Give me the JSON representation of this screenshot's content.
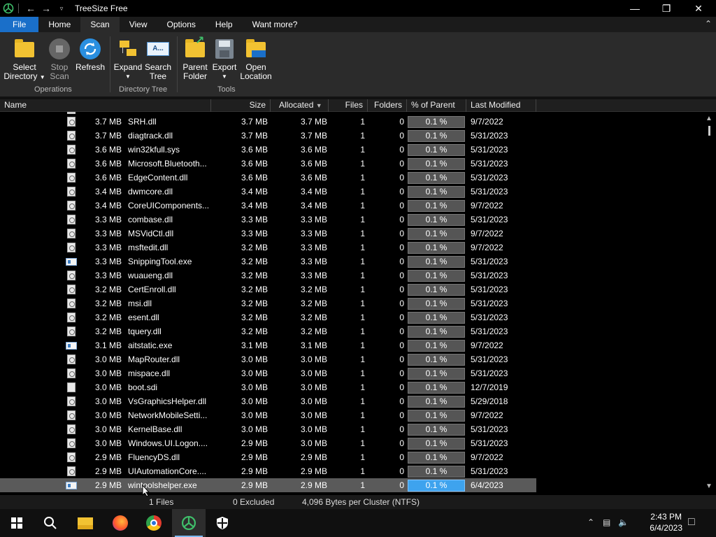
{
  "window": {
    "title": "TreeSize Free"
  },
  "menu": {
    "tabs": [
      "File",
      "Home",
      "Scan",
      "View",
      "Options",
      "Help",
      "Want more?"
    ],
    "active_tab": "Scan"
  },
  "ribbon": {
    "buttons": {
      "select_directory": "Select Directory",
      "stop_scan": "Stop Scan",
      "refresh": "Refresh",
      "expand": "Expand",
      "search_tree": "Search Tree",
      "parent_folder": "Parent Folder",
      "export": "Export",
      "open_location": "Open Location"
    },
    "groups": {
      "operations": "Operations",
      "directory_tree": "Directory Tree",
      "tools": "Tools"
    }
  },
  "columns": {
    "name": "Name",
    "size": "Size",
    "allocated": "Allocated",
    "files": "Files",
    "folders": "Folders",
    "pct_parent": "% of Parent ...",
    "last_modified": "Last Modified"
  },
  "rows": [
    {
      "icon": "dll",
      "tree_size": "3.7 MB",
      "name": "SRH.dll",
      "size": "3.7 MB",
      "allocated": "3.7 MB",
      "files": "1",
      "folders": "0",
      "pct": "0.1 %",
      "modified": "9/7/2022"
    },
    {
      "icon": "dll",
      "tree_size": "3.7 MB",
      "name": "diagtrack.dll",
      "size": "3.7 MB",
      "allocated": "3.7 MB",
      "files": "1",
      "folders": "0",
      "pct": "0.1 %",
      "modified": "5/31/2023"
    },
    {
      "icon": "dll",
      "tree_size": "3.6 MB",
      "name": "win32kfull.sys",
      "size": "3.6 MB",
      "allocated": "3.6 MB",
      "files": "1",
      "folders": "0",
      "pct": "0.1 %",
      "modified": "5/31/2023"
    },
    {
      "icon": "dll",
      "tree_size": "3.6 MB",
      "name": "Microsoft.Bluetooth...",
      "size": "3.6 MB",
      "allocated": "3.6 MB",
      "files": "1",
      "folders": "0",
      "pct": "0.1 %",
      "modified": "5/31/2023"
    },
    {
      "icon": "dll",
      "tree_size": "3.6 MB",
      "name": "EdgeContent.dll",
      "size": "3.6 MB",
      "allocated": "3.6 MB",
      "files": "1",
      "folders": "0",
      "pct": "0.1 %",
      "modified": "5/31/2023"
    },
    {
      "icon": "dll",
      "tree_size": "3.4 MB",
      "name": "dwmcore.dll",
      "size": "3.4 MB",
      "allocated": "3.4 MB",
      "files": "1",
      "folders": "0",
      "pct": "0.1 %",
      "modified": "5/31/2023"
    },
    {
      "icon": "dll",
      "tree_size": "3.4 MB",
      "name": "CoreUIComponents...",
      "size": "3.4 MB",
      "allocated": "3.4 MB",
      "files": "1",
      "folders": "0",
      "pct": "0.1 %",
      "modified": "9/7/2022"
    },
    {
      "icon": "dll",
      "tree_size": "3.3 MB",
      "name": "combase.dll",
      "size": "3.3 MB",
      "allocated": "3.3 MB",
      "files": "1",
      "folders": "0",
      "pct": "0.1 %",
      "modified": "5/31/2023"
    },
    {
      "icon": "dll",
      "tree_size": "3.3 MB",
      "name": "MSVidCtl.dll",
      "size": "3.3 MB",
      "allocated": "3.3 MB",
      "files": "1",
      "folders": "0",
      "pct": "0.1 %",
      "modified": "9/7/2022"
    },
    {
      "icon": "dll",
      "tree_size": "3.3 MB",
      "name": "msftedit.dll",
      "size": "3.2 MB",
      "allocated": "3.3 MB",
      "files": "1",
      "folders": "0",
      "pct": "0.1 %",
      "modified": "9/7/2022"
    },
    {
      "icon": "exe",
      "tree_size": "3.3 MB",
      "name": "SnippingTool.exe",
      "size": "3.2 MB",
      "allocated": "3.3 MB",
      "files": "1",
      "folders": "0",
      "pct": "0.1 %",
      "modified": "5/31/2023"
    },
    {
      "icon": "dll",
      "tree_size": "3.3 MB",
      "name": "wuaueng.dll",
      "size": "3.2 MB",
      "allocated": "3.3 MB",
      "files": "1",
      "folders": "0",
      "pct": "0.1 %",
      "modified": "5/31/2023"
    },
    {
      "icon": "dll",
      "tree_size": "3.2 MB",
      "name": "CertEnroll.dll",
      "size": "3.2 MB",
      "allocated": "3.2 MB",
      "files": "1",
      "folders": "0",
      "pct": "0.1 %",
      "modified": "5/31/2023"
    },
    {
      "icon": "dll",
      "tree_size": "3.2 MB",
      "name": "msi.dll",
      "size": "3.2 MB",
      "allocated": "3.2 MB",
      "files": "1",
      "folders": "0",
      "pct": "0.1 %",
      "modified": "5/31/2023"
    },
    {
      "icon": "dll",
      "tree_size": "3.2 MB",
      "name": "esent.dll",
      "size": "3.2 MB",
      "allocated": "3.2 MB",
      "files": "1",
      "folders": "0",
      "pct": "0.1 %",
      "modified": "5/31/2023"
    },
    {
      "icon": "dll",
      "tree_size": "3.2 MB",
      "name": "tquery.dll",
      "size": "3.2 MB",
      "allocated": "3.2 MB",
      "files": "1",
      "folders": "0",
      "pct": "0.1 %",
      "modified": "5/31/2023"
    },
    {
      "icon": "exe",
      "tree_size": "3.1 MB",
      "name": "aitstatic.exe",
      "size": "3.1 MB",
      "allocated": "3.1 MB",
      "files": "1",
      "folders": "0",
      "pct": "0.1 %",
      "modified": "9/7/2022"
    },
    {
      "icon": "dll",
      "tree_size": "3.0 MB",
      "name": "MapRouter.dll",
      "size": "3.0 MB",
      "allocated": "3.0 MB",
      "files": "1",
      "folders": "0",
      "pct": "0.1 %",
      "modified": "5/31/2023"
    },
    {
      "icon": "dll",
      "tree_size": "3.0 MB",
      "name": "mispace.dll",
      "size": "3.0 MB",
      "allocated": "3.0 MB",
      "files": "1",
      "folders": "0",
      "pct": "0.1 %",
      "modified": "5/31/2023"
    },
    {
      "icon": "file",
      "tree_size": "3.0 MB",
      "name": "boot.sdi",
      "size": "3.0 MB",
      "allocated": "3.0 MB",
      "files": "1",
      "folders": "0",
      "pct": "0.1 %",
      "modified": "12/7/2019"
    },
    {
      "icon": "dll",
      "tree_size": "3.0 MB",
      "name": "VsGraphicsHelper.dll",
      "size": "3.0 MB",
      "allocated": "3.0 MB",
      "files": "1",
      "folders": "0",
      "pct": "0.1 %",
      "modified": "5/29/2018"
    },
    {
      "icon": "dll",
      "tree_size": "3.0 MB",
      "name": "NetworkMobileSetti...",
      "size": "3.0 MB",
      "allocated": "3.0 MB",
      "files": "1",
      "folders": "0",
      "pct": "0.1 %",
      "modified": "9/7/2022"
    },
    {
      "icon": "dll",
      "tree_size": "3.0 MB",
      "name": "KernelBase.dll",
      "size": "3.0 MB",
      "allocated": "3.0 MB",
      "files": "1",
      "folders": "0",
      "pct": "0.1 %",
      "modified": "5/31/2023"
    },
    {
      "icon": "dll",
      "tree_size": "3.0 MB",
      "name": "Windows.UI.Logon....",
      "size": "2.9 MB",
      "allocated": "3.0 MB",
      "files": "1",
      "folders": "0",
      "pct": "0.1 %",
      "modified": "5/31/2023"
    },
    {
      "icon": "dll",
      "tree_size": "2.9 MB",
      "name": "FluencyDS.dll",
      "size": "2.9 MB",
      "allocated": "2.9 MB",
      "files": "1",
      "folders": "0",
      "pct": "0.1 %",
      "modified": "9/7/2022"
    },
    {
      "icon": "dll",
      "tree_size": "2.9 MB",
      "name": "UIAutomationCore....",
      "size": "2.9 MB",
      "allocated": "2.9 MB",
      "files": "1",
      "folders": "0",
      "pct": "0.1 %",
      "modified": "5/31/2023"
    },
    {
      "icon": "exe",
      "tree_size": "2.9 MB",
      "name": "wintoolshelper.exe",
      "size": "2.9 MB",
      "allocated": "2.9 MB",
      "files": "1",
      "folders": "0",
      "pct": "0.1 %",
      "modified": "6/4/2023",
      "selected": true
    }
  ],
  "status": {
    "files": "1 Files",
    "excluded": "0 Excluded",
    "cluster": "4,096 Bytes per Cluster (NTFS)"
  },
  "taskbar": {
    "time": "2:43 PM",
    "date": "6/4/2023"
  },
  "colors": {
    "accent": "#1a6fc9",
    "selected_pct": "#3ea3ee",
    "pct_bar": "#555555"
  }
}
